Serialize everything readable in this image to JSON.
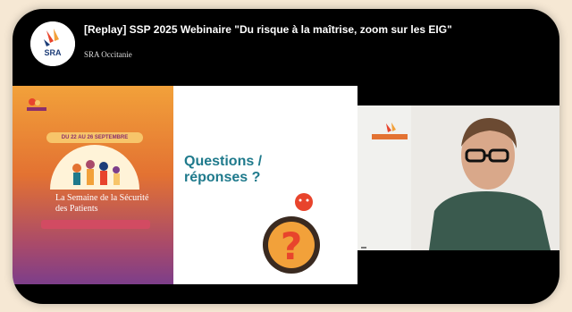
{
  "video": {
    "title": "[Replay] SSP 2025 Webinaire \"Du risque à la maîtrise, zoom sur les EIG\"",
    "channel": "SRA Occitanie",
    "channel_avatar_label": "SRA"
  },
  "slide": {
    "question_line1": "Questions /",
    "question_line2": "réponses ?",
    "poster_title": "La Semaine de la Sécurité des Patients",
    "poster_banner": "DU 22 AU 26 SEPTEMBRE"
  },
  "colors": {
    "background": "#f6e8d4",
    "accent_teal": "#1f7a8c",
    "poster_orange": "#e37232",
    "poster_purple": "#7d3e8a"
  },
  "icons": [
    "play-icon",
    "question-mark-icon",
    "logo-icon"
  ]
}
